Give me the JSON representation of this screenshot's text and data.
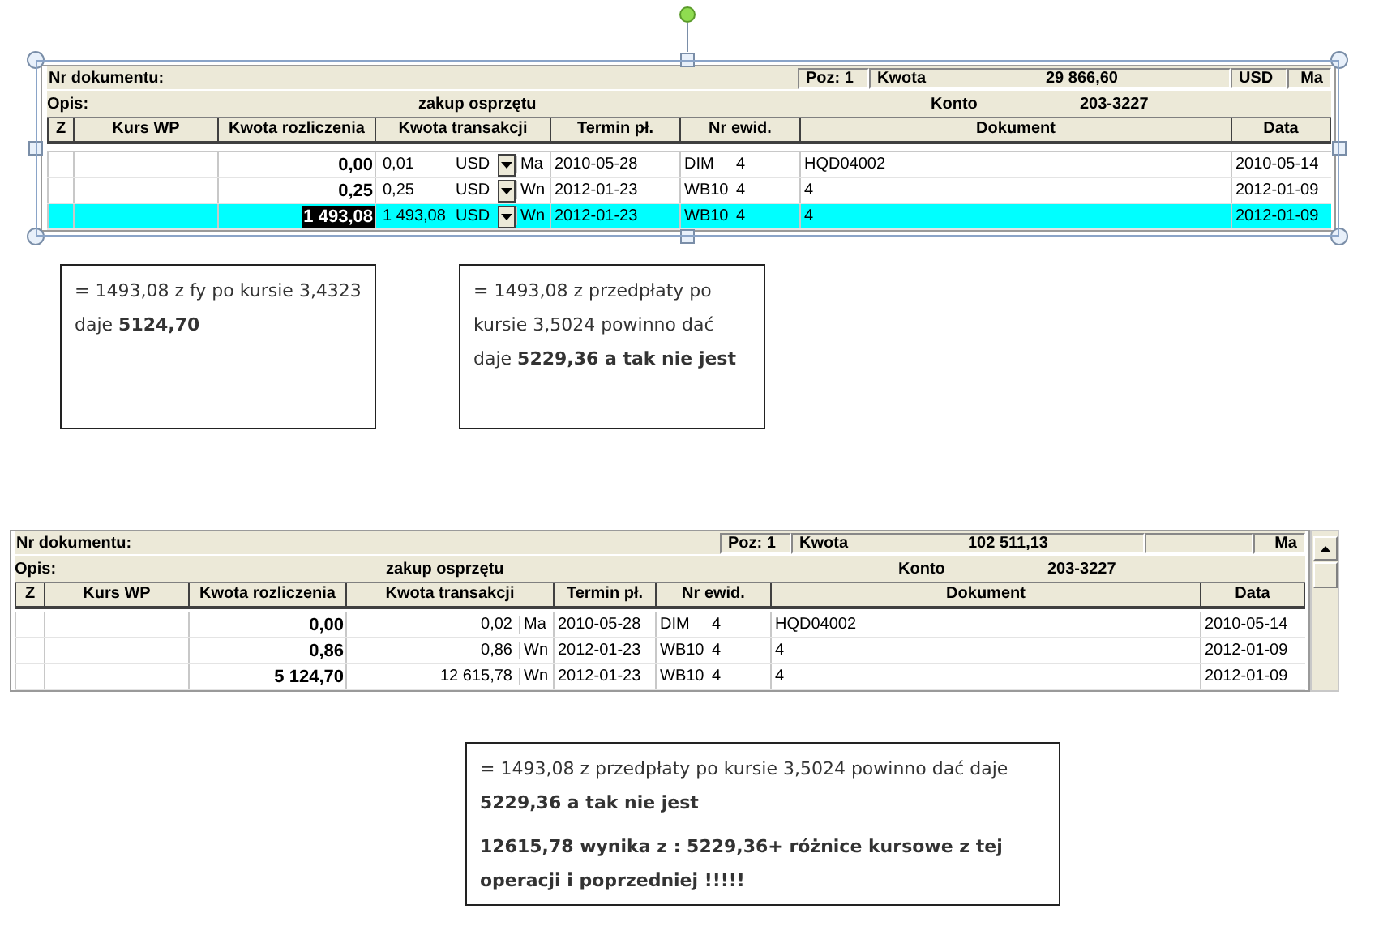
{
  "grids": [
    {
      "frame_selected": true,
      "header": {
        "nr_label": "Nr dokumentu:",
        "poz": "Poz: 1",
        "kwota_label": "Kwota",
        "kwota": "29 866,60",
        "currency": "USD",
        "side": "Ma",
        "opis_label": "Opis:",
        "opis": "zakup osprzętu",
        "konto_label": "Konto",
        "konto": "203-3227"
      },
      "columns": [
        "Z",
        "Kurs WP",
        "Kwota rozliczenia",
        "Kwota transakcji",
        "Termin pł.",
        "Nr ewid.",
        "Dokument",
        "Data"
      ],
      "rows": [
        {
          "selected": false,
          "kwota_rozliczenia": "0,00",
          "kwota_transakcji": "0,01",
          "currency": "USD",
          "side": "Ma",
          "termin": "2010-05-28",
          "ewid_code": "DIM",
          "ewid_no": "4",
          "dokument": "HQD04002",
          "data": "2010-05-14"
        },
        {
          "selected": false,
          "kwota_rozliczenia": "0,25",
          "kwota_transakcji": "0,25",
          "currency": "USD",
          "side": "Wn",
          "termin": "2012-01-23",
          "ewid_code": "WB10",
          "ewid_no": "4",
          "dokument": "4",
          "data": "2012-01-09"
        },
        {
          "selected": true,
          "kwota_rozliczenia": "1 493,08",
          "kwota_transakcji": "1 493,08",
          "currency": "USD",
          "side": "Wn",
          "termin": "2012-01-23",
          "ewid_code": "WB10",
          "ewid_no": "4",
          "dokument": "4",
          "data": "2012-01-09"
        }
      ]
    },
    {
      "has_scrollbar": true,
      "header": {
        "nr_label": "Nr dokumentu:",
        "poz": "Poz: 1",
        "kwota_label": "Kwota",
        "kwota": "102 511,13",
        "side": "Ma",
        "opis_label": "Opis:",
        "opis": "zakup osprzętu",
        "konto_label": "Konto",
        "konto": "203-3227"
      },
      "columns": [
        "Z",
        "Kurs WP",
        "Kwota rozliczenia",
        "Kwota transakcji",
        "Termin pł.",
        "Nr ewid.",
        "Dokument",
        "Data"
      ],
      "rows": [
        {
          "selected": false,
          "kwota_rozliczenia": "0,00",
          "kwota_transakcji": "0,02",
          "side": "Ma",
          "termin": "2010-05-28",
          "ewid_code": "DIM",
          "ewid_no": "4",
          "dokument": "HQD04002",
          "data": "2010-05-14"
        },
        {
          "selected": false,
          "kwota_rozliczenia": "0,86",
          "kwota_transakcji": "0,86",
          "side": "Wn",
          "termin": "2012-01-23",
          "ewid_code": "WB10",
          "ewid_no": "4",
          "dokument": "4",
          "data": "2012-01-09"
        },
        {
          "selected": false,
          "kwota_rozliczenia": "5 124,70",
          "kwota_transakcji": "12 615,78",
          "side": "Wn",
          "termin": "2012-01-23",
          "ewid_code": "WB10",
          "ewid_no": "4",
          "dokument": "4",
          "data": "2012-01-09"
        }
      ]
    }
  ],
  "notes": [
    {
      "paragraphs": [
        "= 1493,08  z fy po kursie 3,4323 daje  **5124,70**"
      ]
    },
    {
      "paragraphs": [
        "= 1493,08  z przedpłaty  po kursie 3,5024 powinno dać daje  **5229,36  a tak nie jest**"
      ]
    },
    {
      "paragraphs": [
        "= 1493,08  z przedpłaty  po kursie 3,5024  powinno dać daje  **5229,36  a tak nie jest**",
        "**12615,78  wynika z : 5229,36+  różnice kursowe z tej operacji i poprzedniej !!!!!**"
      ]
    }
  ]
}
